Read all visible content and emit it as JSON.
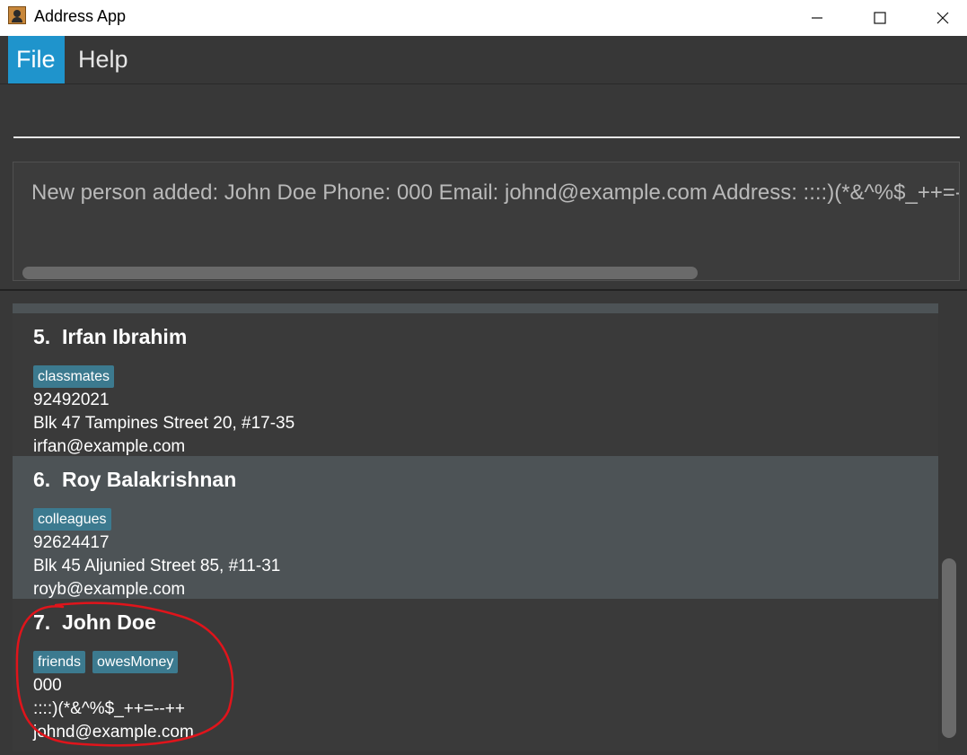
{
  "window": {
    "title": "Address App",
    "icon": "address-book-icon",
    "controls": {
      "minimize": "—",
      "maximize": "☐",
      "close": "✕"
    }
  },
  "menu": {
    "items": [
      {
        "label": "File",
        "active": true
      },
      {
        "label": "Help",
        "active": false
      }
    ],
    "accent": "#1f94cc"
  },
  "command_box": {
    "value": "",
    "placeholder": ""
  },
  "result_display": {
    "text": "New person added: John Doe Phone: 000 Email: johnd@example.com Address: ::::)(*&^%$_++=--++ Tags: [friends][owesMoney]"
  },
  "person_list": {
    "cards": [
      {
        "index": "5.",
        "name": "Irfan Ibrahim",
        "tags": [
          "classmates"
        ],
        "phone": "92492021",
        "address": "Blk 47 Tampines Street 20, #17-35",
        "email": "irfan@example.com"
      },
      {
        "index": "6.",
        "name": "Roy Balakrishnan",
        "tags": [
          "colleagues"
        ],
        "phone": "92624417",
        "address": "Blk 45 Aljunied Street 85, #11-31",
        "email": "royb@example.com"
      },
      {
        "index": "7.",
        "name": "John Doe",
        "tags": [
          "friends",
          "owesMoney"
        ],
        "phone": "000",
        "address": "::::)(*&^%$_++=--++",
        "email": "johnd@example.com"
      }
    ],
    "tag_color": "#3c7a8f"
  },
  "annotation": {
    "color": "#e0141b",
    "highlighted_card": "7."
  }
}
